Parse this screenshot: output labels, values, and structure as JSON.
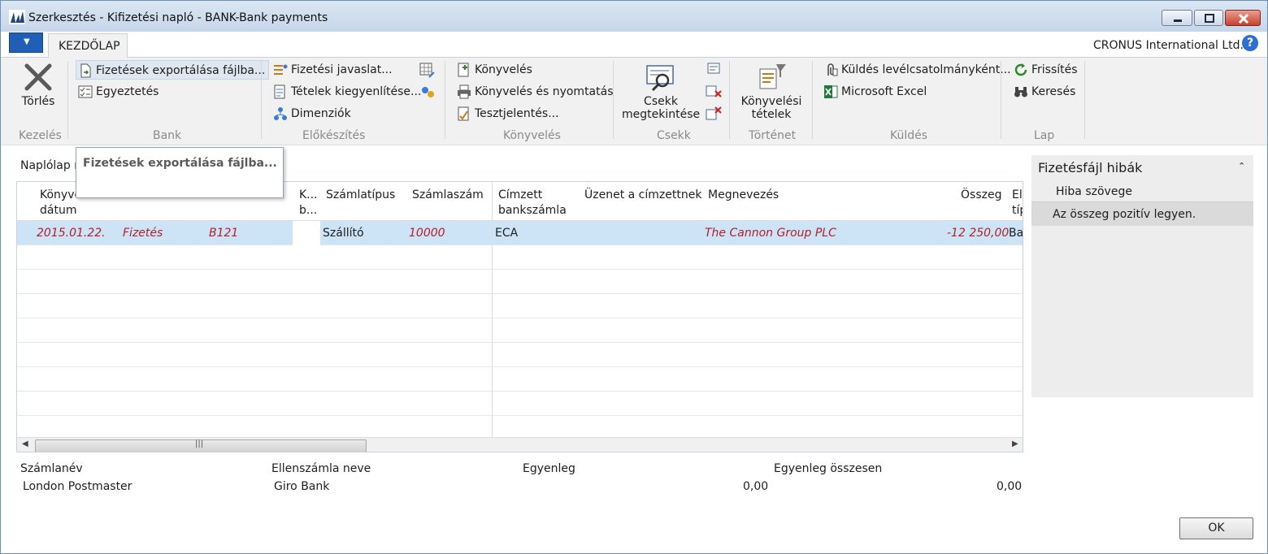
{
  "window": {
    "title": "Szerkesztés - Kifizetési napló - BANK-Bank payments"
  },
  "tabs": [
    {
      "label": "KEZDŐLAP"
    }
  ],
  "company": "CRONUS International Ltd.",
  "help_label": "?",
  "ribbon": {
    "torles": "Törlés",
    "kezeles_group": "Kezelés",
    "fizetesek_export": "Fizetések exportálása fájlba...",
    "egyeztetes": "Egyeztetés",
    "bank_group": "Bank",
    "fizetesi_javaslat": "Fizetési javaslat...",
    "tetelek_kiegyenlitese": "Tételek kiegyenlítése...",
    "dimenziok": "Dimenziók",
    "elokeszites_group": "Előkészítés",
    "konyveles": "Könyvelés",
    "konyveles_nyomtatas": "Könyvelés és nyomtatás",
    "tesztjelentes": "Tesztjelentés...",
    "konyveles_group": "Könyvelés",
    "csekk_line1": "Csekk",
    "csekk_line2": "megtekintése",
    "csekk_group": "Csekk",
    "konyvelesi_line1": "Könyvelési",
    "konyvelesi_line2": "tételek",
    "tortenet_group": "Történet",
    "kuldes_level": "Küldés levélcsatolmányként...",
    "microsoft_excel": "Microsoft Excel",
    "kuldes_group": "Küldés",
    "frissites": "Frissítés",
    "kereses": "Keresés",
    "lap_group": "Lap"
  },
  "tooltip": "Fizetések exportálása fájlba...",
  "section_title": "Naplólap n",
  "grid": {
    "headers": {
      "konyv_line1": "Könyve",
      "konyv_line2": "dátum",
      "k_line1": "K...",
      "k_line2": "b...",
      "szamlatipus": "Számlatípus",
      "szamlaszam": "Számlaszám",
      "cimzett_line1": "Címzett",
      "cimzett_line2": "bankszámla",
      "uzenet": "Üzenet a címzettnek",
      "megnevezes": "Megnevezés",
      "osszeg": "Összeg",
      "el_line1": "El",
      "el_line2": "típ"
    },
    "rows": [
      {
        "datum": "2015.01.22.",
        "tipus": "Fizetés",
        "bizonylat": "B121",
        "szamlatipus": "Szállító",
        "szamlaszam": "10000",
        "cimzett": "ECA",
        "megnevezes": "The Cannon Group PLC",
        "osszeg": "-12 250,00",
        "el": "Ba"
      }
    ]
  },
  "factbox": {
    "title": "Fizetésfájl hibák",
    "column": "Hiba szövege",
    "rows": [
      "Az összeg pozitív legyen."
    ]
  },
  "footer": {
    "szamlanev_label": "Számlanév",
    "szamlanev_value": "London Postmaster",
    "ellenszamla_label": "Ellenszámla neve",
    "ellenszamla_value": "Giro Bank",
    "egyenleg_label": "Egyenleg",
    "egyenleg_value": "0,00",
    "egyenleg_osszesen_label": "Egyenleg összesen",
    "egyenleg_osszesen_value": "0,00"
  },
  "ok_label": "OK",
  "colors": {
    "accent": "#1f5fb5",
    "selected_row": "#cde3f6",
    "red_text": "#b3202a"
  }
}
